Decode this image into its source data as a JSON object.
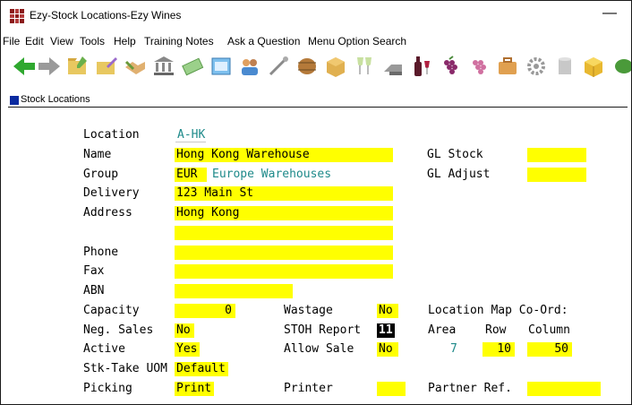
{
  "window": {
    "title": "Ezy-Stock Locations-Ezy Wines",
    "minimize": "—"
  },
  "menu": [
    "File",
    "Edit",
    "View",
    "Tools",
    "Help",
    "Training Notes",
    "Ask a Question",
    "Menu Option Search"
  ],
  "toolbar": {
    "icons": [
      "back-arrow-icon",
      "forward-arrow-icon",
      "folder-open-icon",
      "folder-edit-icon",
      "handshake-icon",
      "bank-icon",
      "money-icon",
      "window-icon",
      "users-icon",
      "tools-icon",
      "barrel-icon",
      "box-icon",
      "wine-glasses-icon",
      "scanner-icon",
      "wine-bottle-icon",
      "grapes-icon",
      "grapes-pink-icon",
      "briefcase-icon",
      "gear-icon",
      "cylinder-icon",
      "cube-icon",
      "leaf-icon"
    ]
  },
  "tab": {
    "label": "Stock Locations"
  },
  "form": {
    "location": {
      "label": "Location",
      "value": "A-HK"
    },
    "name": {
      "label": "Name",
      "value": "Hong Kong Warehouse"
    },
    "group": {
      "label": "Group",
      "code": "EUR",
      "desc": "Europe Warehouses"
    },
    "delivery": {
      "label": "Delivery",
      "value": "123 Main St"
    },
    "address": {
      "label": "Address",
      "line1": "Hong Kong",
      "line2": ""
    },
    "phone": {
      "label": "Phone",
      "value": ""
    },
    "fax": {
      "label": "Fax",
      "value": ""
    },
    "abn": {
      "label": "ABN",
      "value": ""
    },
    "capacity": {
      "label": "Capacity",
      "value": "0"
    },
    "neg_sales": {
      "label": "Neg. Sales",
      "value": "No"
    },
    "active": {
      "label": "Active",
      "value": "Yes"
    },
    "stk_take_uom": {
      "label": "Stk-Take UOM",
      "value": "Default"
    },
    "picking": {
      "label": "Picking",
      "value": "Print"
    },
    "wastage": {
      "label": "Wastage",
      "value": "No"
    },
    "stoh_report": {
      "label": "STOH Report",
      "value": "11"
    },
    "allow_sale": {
      "label": "Allow Sale",
      "value": "No"
    },
    "printer": {
      "label": "Printer",
      "value": ""
    },
    "gl_stock": {
      "label": "GL Stock",
      "value": ""
    },
    "gl_adjust": {
      "label": "GL Adjust",
      "value": ""
    },
    "map": {
      "label": "Location Map Co-Ord:",
      "area_label": "Area",
      "row_label": "Row",
      "column_label": "Column",
      "area": "7",
      "row": "10",
      "column": "50"
    },
    "partner_ref": {
      "label": "Partner Ref.",
      "value": ""
    }
  }
}
